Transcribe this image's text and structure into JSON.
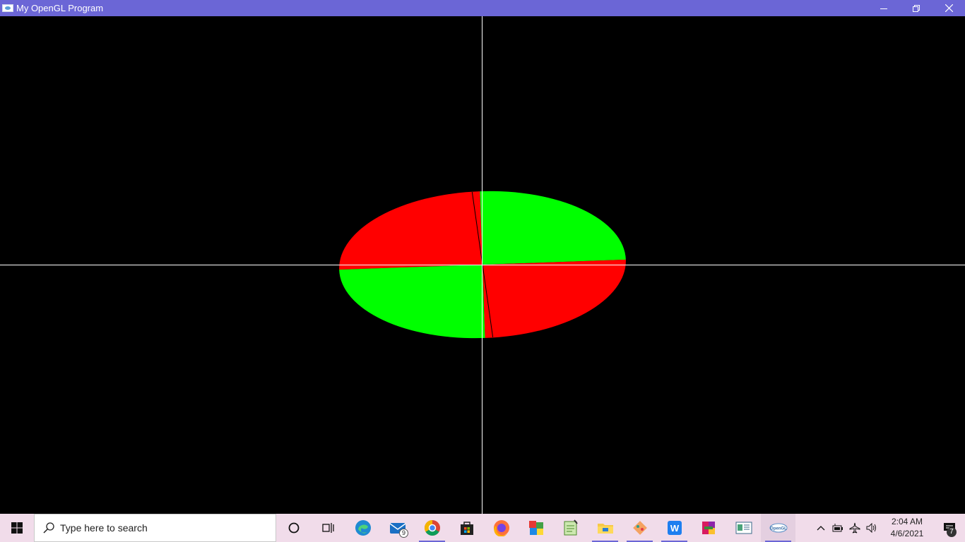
{
  "window": {
    "title": "My OpenGL Program",
    "controls": {
      "minimize": "minimize-icon",
      "restore": "restore-icon",
      "close": "close-icon"
    }
  },
  "scene": {
    "background": "#000000",
    "axis_color": "#ffffff",
    "colors": {
      "red": "#ff0000",
      "green": "#00ff00"
    }
  },
  "taskbar": {
    "search_placeholder": "Type here to search",
    "apps": [
      {
        "name": "cortana",
        "icon": "cortana-circle-icon"
      },
      {
        "name": "task-view",
        "icon": "task-view-icon"
      },
      {
        "name": "edge",
        "icon": "edge-icon"
      },
      {
        "name": "mail",
        "icon": "mail-icon",
        "badge": "9"
      },
      {
        "name": "chrome",
        "icon": "chrome-icon"
      },
      {
        "name": "store",
        "icon": "store-icon"
      },
      {
        "name": "firefox",
        "icon": "firefox-icon"
      },
      {
        "name": "app-colorful",
        "icon": "colorful-squares-icon"
      },
      {
        "name": "notepad",
        "icon": "notepad-icon"
      },
      {
        "name": "file-explorer",
        "icon": "folder-icon"
      },
      {
        "name": "git",
        "icon": "git-icon"
      },
      {
        "name": "wps",
        "icon": "wps-icon"
      },
      {
        "name": "winrar",
        "icon": "winrar-icon"
      },
      {
        "name": "app-window",
        "icon": "app-window-icon"
      },
      {
        "name": "opengl",
        "icon": "opengl-icon"
      }
    ],
    "clock": {
      "time": "2:04 AM",
      "date": "4/6/2021"
    },
    "notifications_count": "7"
  }
}
